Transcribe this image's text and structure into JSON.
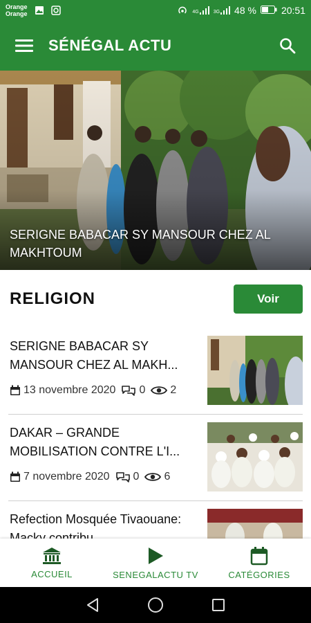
{
  "status_bar": {
    "carrier_1": "Orange",
    "carrier_2": "Orange",
    "network_1": "4G",
    "network_2": "3G",
    "battery": "48 %",
    "time": "20:51"
  },
  "app_bar": {
    "title": "SÉNÉGAL ACTU",
    "menu_icon": "hamburger-menu-icon",
    "search_icon": "search-icon"
  },
  "hero": {
    "title": "SERIGNE BABACAR SY MANSOUR CHEZ AL MAKHTOUM"
  },
  "section": {
    "title": "RELIGION",
    "button_label": "Voir"
  },
  "articles": [
    {
      "title": "SERIGNE BABACAR SY MANSOUR CHEZ AL MAKH...",
      "date": "13 novembre 2020",
      "comments": "0",
      "views": "2"
    },
    {
      "title": "DAKAR – GRANDE MOBILISATION CONTRE L'I...",
      "date": "7 novembre 2020",
      "comments": "0",
      "views": "6"
    },
    {
      "title": "Refection Mosquée Tivaouane: Macky contribu..."
    }
  ],
  "bottom_nav": [
    {
      "label": "ACCUEIL",
      "icon": "home-building-icon"
    },
    {
      "label": "SENEGALACTU TV",
      "icon": "play-icon"
    },
    {
      "label": "CATÉGORIES",
      "icon": "calendar-icon"
    }
  ],
  "colors": {
    "primary": "#2a8a37",
    "text": "#111111",
    "divider": "#cfcfcf"
  }
}
